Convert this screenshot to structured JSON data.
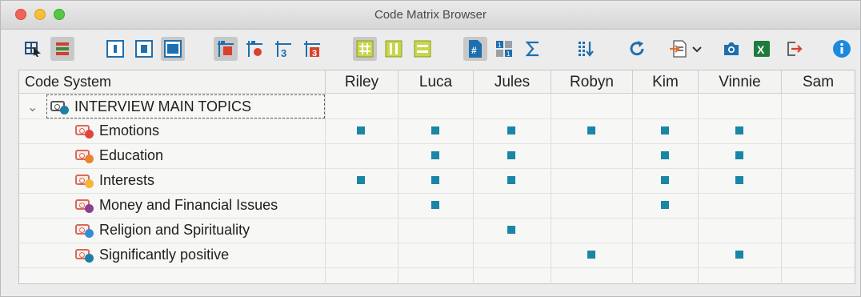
{
  "window": {
    "title": "Code Matrix Browser"
  },
  "toolbar": {
    "buttons": [
      {
        "icon": "select-cells-icon",
        "active": false
      },
      {
        "icon": "color-bars-icon",
        "active": true
      },
      {
        "icon": "view-narrow-icon",
        "active": false
      },
      {
        "icon": "view-medium-icon",
        "active": false
      },
      {
        "icon": "view-wide-icon",
        "active": true
      },
      {
        "icon": "code-grid-icon",
        "active": true
      },
      {
        "icon": "code-node-icon",
        "active": false
      },
      {
        "icon": "numbered-code-icon",
        "active": false
      },
      {
        "icon": "numbered-code-red-icon",
        "active": false
      },
      {
        "icon": "grid-hash-icon",
        "active": true
      },
      {
        "icon": "columns-icon",
        "active": false
      },
      {
        "icon": "rows-icon",
        "active": false
      },
      {
        "icon": "hash-icon",
        "active": true
      },
      {
        "icon": "numbers-grid-icon",
        "active": false
      },
      {
        "icon": "sigma-icon",
        "active": false
      },
      {
        "icon": "sort-down-icon",
        "active": false
      },
      {
        "icon": "refresh-icon",
        "active": false
      },
      {
        "icon": "export-icon",
        "active": false
      },
      {
        "icon": "camera-icon",
        "active": false
      },
      {
        "icon": "excel-icon",
        "active": false
      },
      {
        "icon": "exit-icon",
        "active": false
      },
      {
        "icon": "info-icon",
        "active": false
      }
    ]
  },
  "matrix": {
    "header_code": "Code System",
    "columns": [
      "Riley",
      "Luca",
      "Jules",
      "Robyn",
      "Kim",
      "Vinnie",
      "Sam"
    ],
    "root": {
      "label": "INTERVIEW MAIN TOPICS",
      "dot_color": "#1d7ea6"
    },
    "rows": [
      {
        "label": "Emotions",
        "dot_color": "#e0463c",
        "cells": [
          1,
          1,
          1,
          1,
          1,
          1,
          0
        ]
      },
      {
        "label": "Education",
        "dot_color": "#e8842f",
        "cells": [
          0,
          1,
          1,
          0,
          1,
          1,
          0
        ]
      },
      {
        "label": "Interests",
        "dot_color": "#f2b63a",
        "cells": [
          1,
          1,
          1,
          0,
          1,
          1,
          0
        ]
      },
      {
        "label": "Money and Financial Issues",
        "dot_color": "#8a3f8f",
        "cells": [
          0,
          1,
          0,
          0,
          1,
          0,
          0
        ]
      },
      {
        "label": "Religion and Spirituality",
        "dot_color": "#2f8fd6",
        "cells": [
          0,
          0,
          1,
          0,
          0,
          0,
          0
        ]
      },
      {
        "label": "Significantly positive",
        "dot_color": "#1d7ea6",
        "cells": [
          0,
          0,
          0,
          1,
          0,
          1,
          0
        ]
      }
    ]
  }
}
